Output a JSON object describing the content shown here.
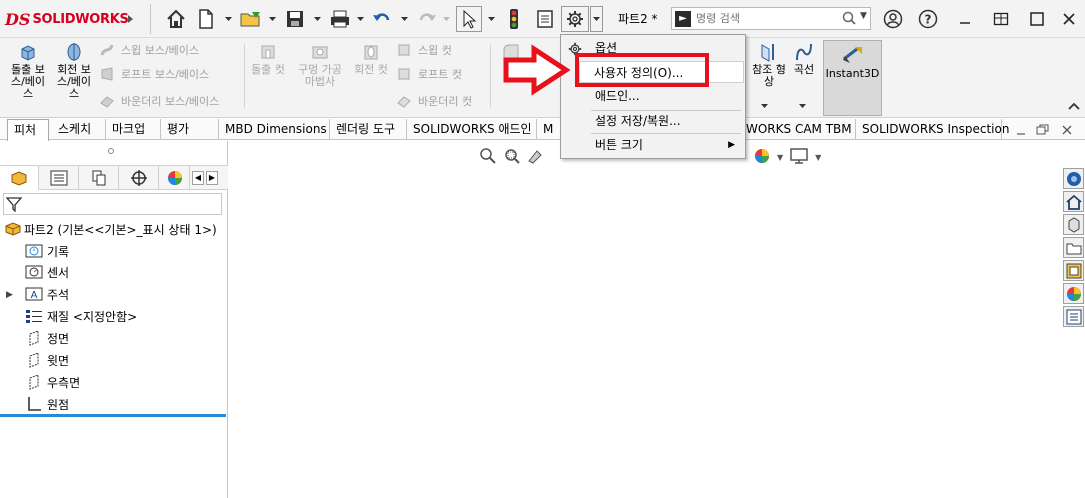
{
  "app": {
    "brand": "SOLIDWORKS",
    "logo_mark": "DS",
    "doc_title": "파트2 *"
  },
  "search": {
    "placeholder": "명령 검색",
    "icon": "run-command-icon"
  },
  "ribbon": {
    "big": [
      {
        "label": "돌출 보\n스/베이\n스",
        "enabled": true,
        "icon": "extruded-boss-icon"
      },
      {
        "label": "회전 보\n스/베이\n스",
        "enabled": true,
        "icon": "revolved-boss-icon"
      },
      {
        "label": "돌출 컷",
        "enabled": false,
        "icon": "extruded-cut-icon"
      },
      {
        "label": "구멍 가공\n마법사",
        "enabled": false,
        "icon": "hole-wizard-icon"
      },
      {
        "label": "회전 컷",
        "enabled": false,
        "icon": "revolved-cut-icon"
      }
    ],
    "small_boss": [
      "스윕 보스/베이스",
      "로프트 보스/베이스",
      "바운더리 보스/베이스"
    ],
    "small_cut": [
      "스윕 컷",
      "로프트 컷",
      "바운더리 컷"
    ],
    "right_partial": [
      {
        "label": "참조 형\n상"
      },
      {
        "label": "곡선"
      }
    ],
    "instant3d": "Instant3D"
  },
  "tabs": [
    {
      "label": "피처",
      "active": true
    },
    {
      "label": "스케치"
    },
    {
      "label": "마크업"
    },
    {
      "label": "평가"
    },
    {
      "label": "MBD Dimensions"
    },
    {
      "label": "렌더링 도구"
    },
    {
      "label": "SOLIDWORKS 애드인"
    },
    {
      "label": "M"
    },
    {
      "label": "WORKS CAM TBM"
    },
    {
      "label": "SOLIDWORKS Inspection"
    }
  ],
  "tree": {
    "root": "파트2  (기본<<기본>_표시 상태 1>)",
    "items": [
      {
        "label": "기록",
        "icon": "history-icon"
      },
      {
        "label": "센서",
        "icon": "sensor-icon"
      },
      {
        "label": "주석",
        "icon": "annotation-icon",
        "expandable": true
      },
      {
        "label": "재질 <지정안함>",
        "icon": "material-icon"
      },
      {
        "label": "정면",
        "icon": "plane-icon"
      },
      {
        "label": "윗면",
        "icon": "plane-icon"
      },
      {
        "label": "우측면",
        "icon": "plane-icon"
      },
      {
        "label": "원점",
        "icon": "origin-icon"
      }
    ]
  },
  "menu": {
    "items": [
      {
        "label": "옵션",
        "icon": "gear-icon"
      },
      {
        "label": "사용자 정의(O)...",
        "highlighted": true
      },
      {
        "label": "애드인..."
      },
      {
        "label": "설정 저장/복원..."
      },
      {
        "label": "버튼 크기",
        "submenu": true
      }
    ]
  },
  "colors": {
    "brand_red": "#d6001c",
    "annotation_red": "#e8101a",
    "rollback_blue": "#2b8ad3"
  }
}
